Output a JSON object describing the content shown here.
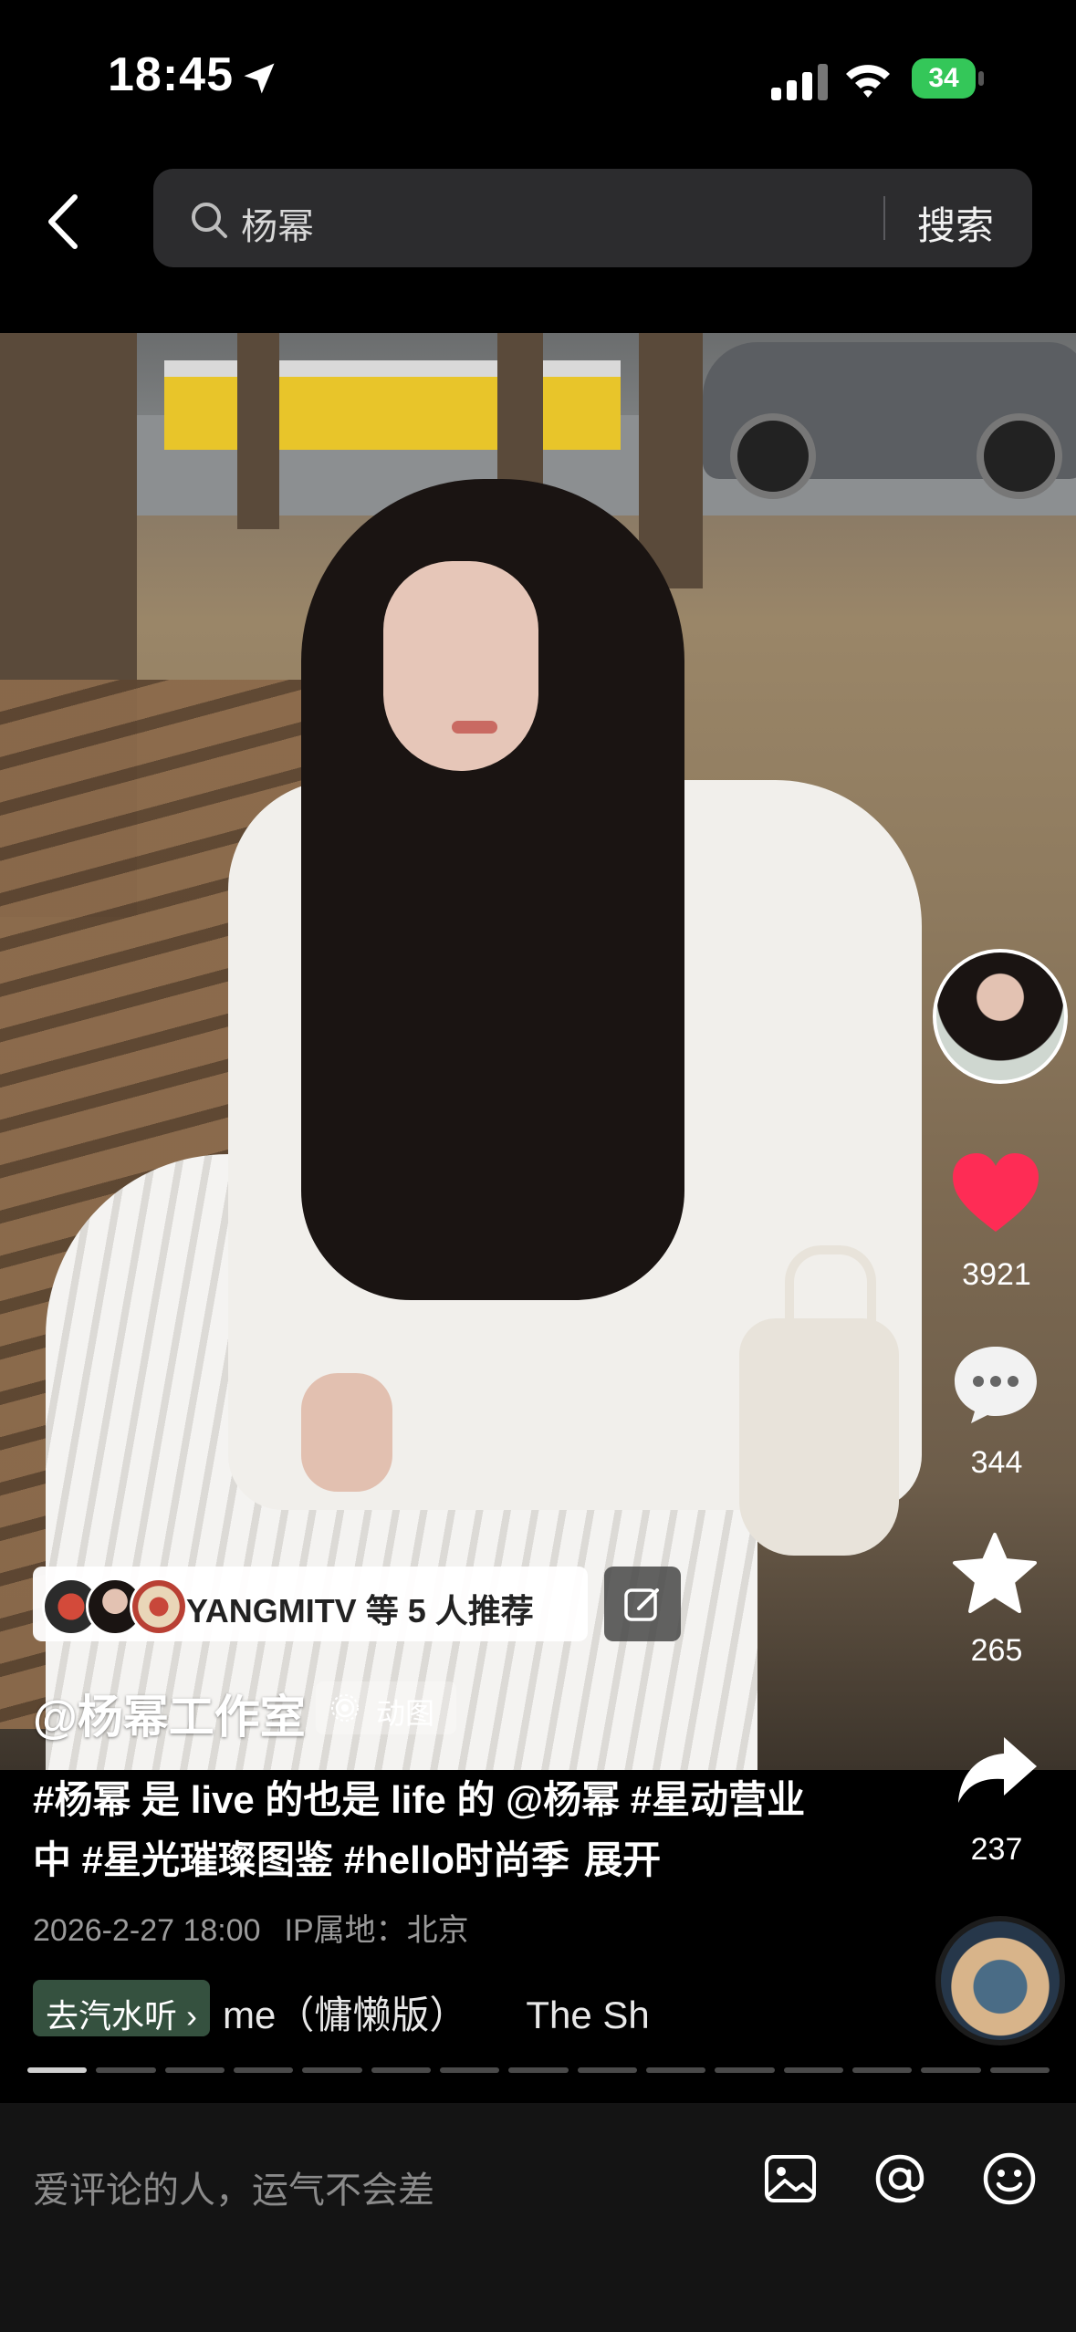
{
  "status_bar": {
    "time": "18:45",
    "battery": "34"
  },
  "search": {
    "query": "杨幂",
    "button_label": "搜索"
  },
  "recommend": {
    "label": "YANGMITV 等 5 人推荐"
  },
  "post": {
    "author": "@杨幂工作室",
    "tag": "动图",
    "caption": "#杨幂 是 live 的也是 life 的 @杨幂  #星动营业中 #星光璀璨图鉴 #hello时尚季",
    "expand_label": "展开",
    "date": "2026-2-27 18:00",
    "ip_location": "IP属地：北京"
  },
  "music": {
    "button_label": "去汽水听 ›",
    "track_parts": [
      "me（慵懒版）",
      "The Sh"
    ]
  },
  "progress": {
    "segment_count": 15,
    "active_index": 0
  },
  "actions": {
    "likes": "3921",
    "comments": "344",
    "favorites": "265",
    "shares": "237"
  },
  "comment_bar": {
    "placeholder": "爱评论的人，运气不会差"
  },
  "colors": {
    "like": "#fe2c55",
    "music_button": "#35513f",
    "battery": "#34c759"
  }
}
